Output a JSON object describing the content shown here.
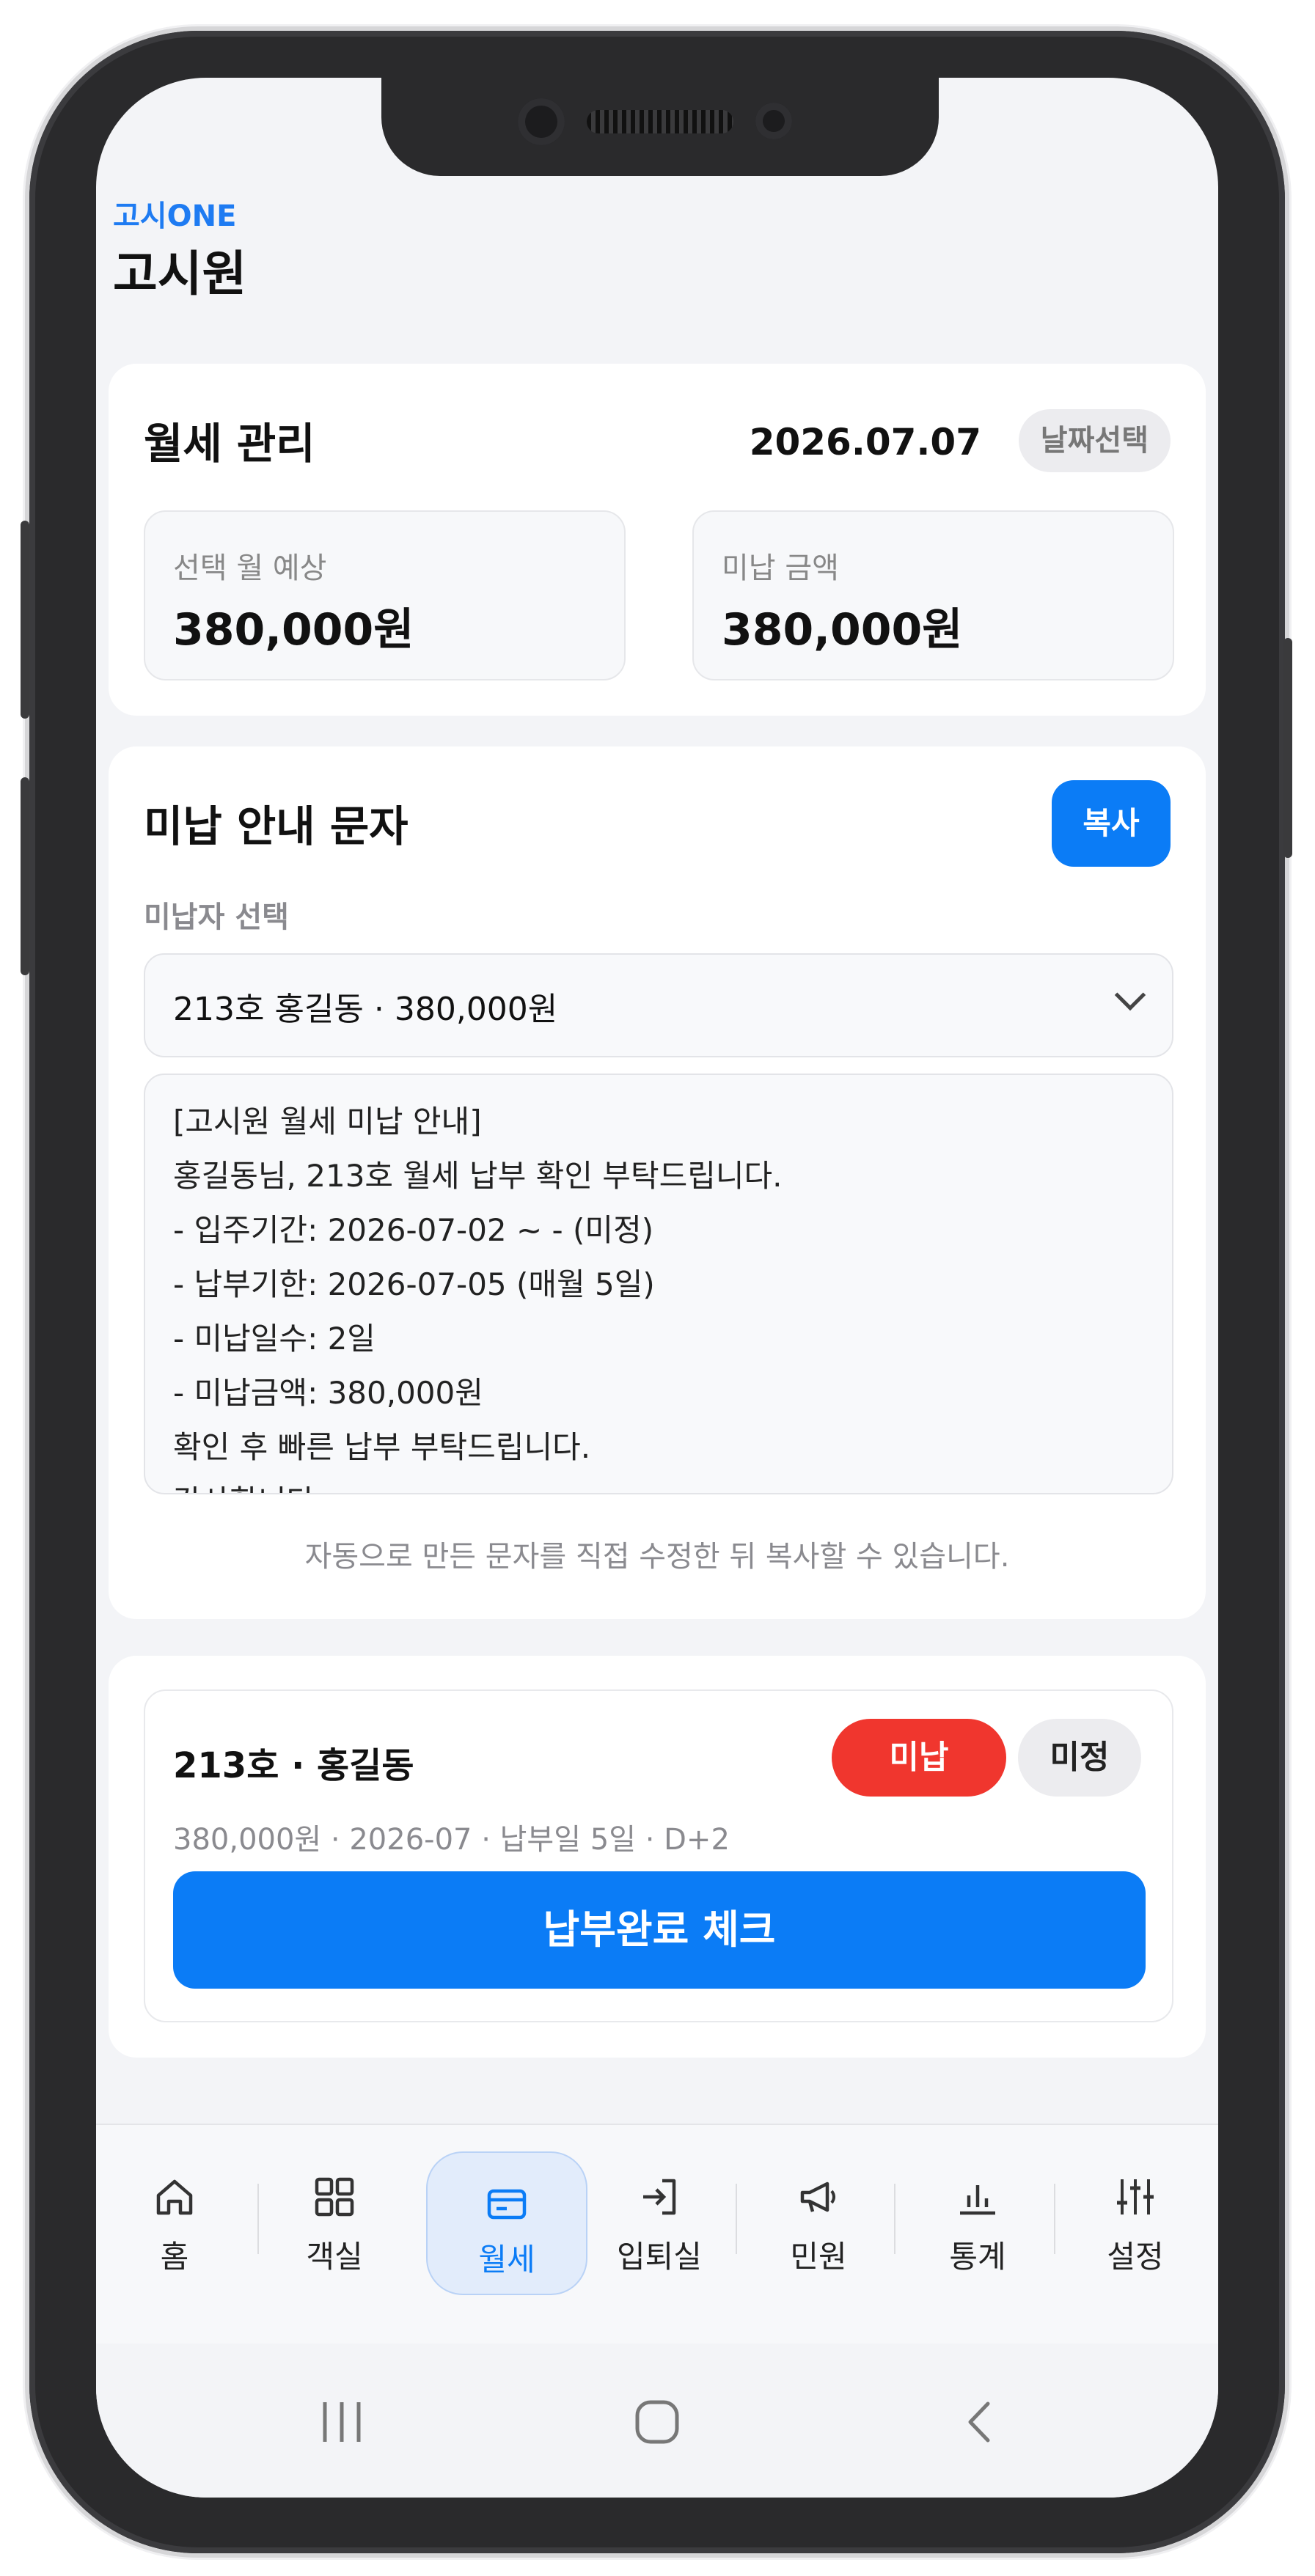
{
  "colors": {
    "accent": "#0b7cf6",
    "danger": "#f0362e",
    "background": "#f3f4f7"
  },
  "header": {
    "brand": "고시ONE",
    "title": "고시원"
  },
  "rent_card": {
    "title": "월세 관리",
    "date": "2026.07.07",
    "date_pick_label": "날짜선택",
    "expected": {
      "label": "선택 월 예상",
      "value": "380,000원"
    },
    "unpaid": {
      "label": "미납 금액",
      "value": "380,000원"
    }
  },
  "notice_card": {
    "title": "미납 안내 문자",
    "copy_label": "복사",
    "select_label": "미납자 선택",
    "selected_value": "213호 홍길동 · 380,000원",
    "message_lines": [
      "[고시원 월세 미납 안내]",
      "홍길동님, 213호 월세 납부 확인 부탁드립니다.",
      "- 입주기간: 2026-07-02 ~ - (미정)",
      "- 납부기한: 2026-07-05 (매월 5일)",
      "- 미납일수: 2일",
      "- 미납금액: 380,000원",
      "확인 후 빠른 납부 부탁드립니다.",
      "감사합니다."
    ],
    "hint": "자동으로 만든 문자를 직접 수정한 뒤 복사할 수 있습니다."
  },
  "tenant_card": {
    "room": "213호 · 홍길동",
    "status_badge": "미납",
    "term_badge": "미정",
    "meta": "380,000원 · 2026-07 · 납부일 5일 · D+2",
    "pay_button": "납부완료 체크"
  },
  "tabs": [
    {
      "label": "홈",
      "icon": "home-icon"
    },
    {
      "label": "객실",
      "icon": "grid-icon"
    },
    {
      "label": "월세",
      "icon": "card-icon",
      "active": true
    },
    {
      "label": "입퇴실",
      "icon": "login-icon"
    },
    {
      "label": "민원",
      "icon": "megaphone-icon"
    },
    {
      "label": "통계",
      "icon": "bar-chart-icon"
    },
    {
      "label": "설정",
      "icon": "sliders-icon"
    }
  ],
  "system_nav": {
    "recents": "recents-icon",
    "home": "home-button-icon",
    "back": "back-icon"
  }
}
